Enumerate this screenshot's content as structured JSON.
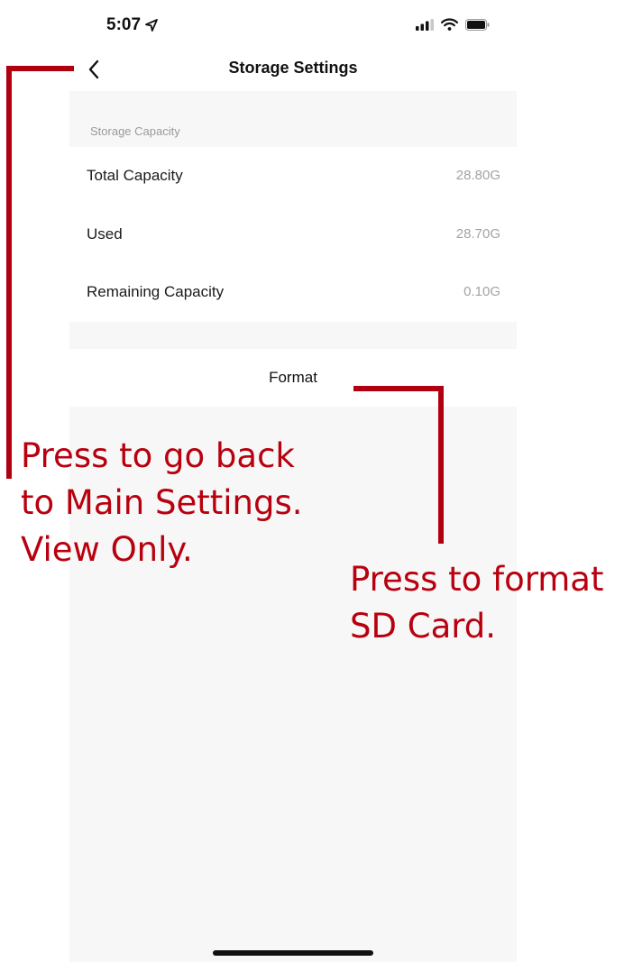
{
  "status_bar": {
    "time": "5:07"
  },
  "nav": {
    "title": "Storage Settings"
  },
  "storage": {
    "section_title": "Storage Capacity",
    "rows": [
      {
        "label": "Total Capacity",
        "value": "28.80G"
      },
      {
        "label": "Used",
        "value": "28.70G"
      },
      {
        "label": "Remaining Capacity",
        "value": "0.10G"
      }
    ]
  },
  "actions": {
    "format_label": "Format"
  },
  "annotations": {
    "back": {
      "lines": [
        "Press to go back",
        "to Main Settings.",
        "View Only."
      ]
    },
    "format": {
      "lines": [
        "Press to format",
        "SD Card."
      ]
    }
  },
  "colors": {
    "annotation": "#b8000f",
    "section_bg": "#f7f7f7"
  },
  "icons": {
    "back": "chevron-left-icon",
    "location": "location-arrow-icon",
    "signal": "cellular-signal-icon",
    "wifi": "wifi-icon",
    "battery": "battery-icon"
  }
}
